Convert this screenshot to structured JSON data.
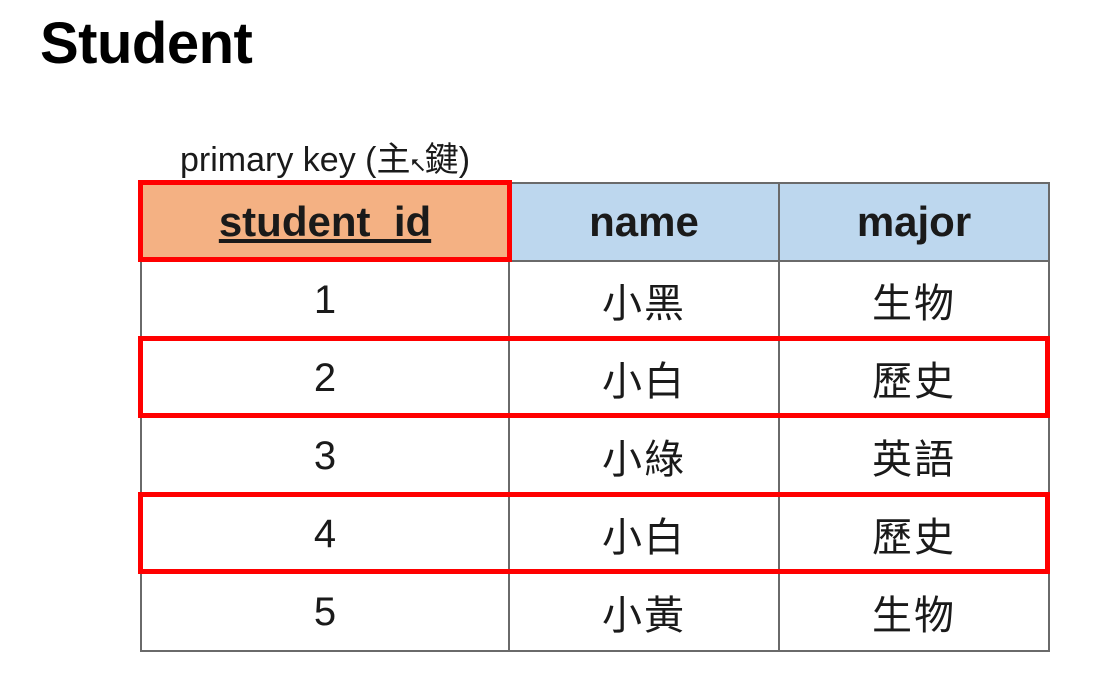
{
  "title": "Student",
  "pk_label_prefix": "primary key (主",
  "pk_label_suffix": "鍵)",
  "chart_data": {
    "type": "table",
    "columns": [
      {
        "key": "student_id",
        "label": "student_id",
        "is_primary_key": true
      },
      {
        "key": "name",
        "label": "name",
        "is_primary_key": false
      },
      {
        "key": "major",
        "label": "major",
        "is_primary_key": false
      }
    ],
    "rows": [
      {
        "student_id": "1",
        "name": "小黑",
        "major": "生物",
        "highlighted": false
      },
      {
        "student_id": "2",
        "name": "小白",
        "major": "歷史",
        "highlighted": true
      },
      {
        "student_id": "3",
        "name": "小綠",
        "major": "英語",
        "highlighted": false
      },
      {
        "student_id": "4",
        "name": "小白",
        "major": "歷史",
        "highlighted": true
      },
      {
        "student_id": "5",
        "name": "小黃",
        "major": "生物",
        "highlighted": false
      }
    ],
    "header_pk_highlighted": true
  }
}
